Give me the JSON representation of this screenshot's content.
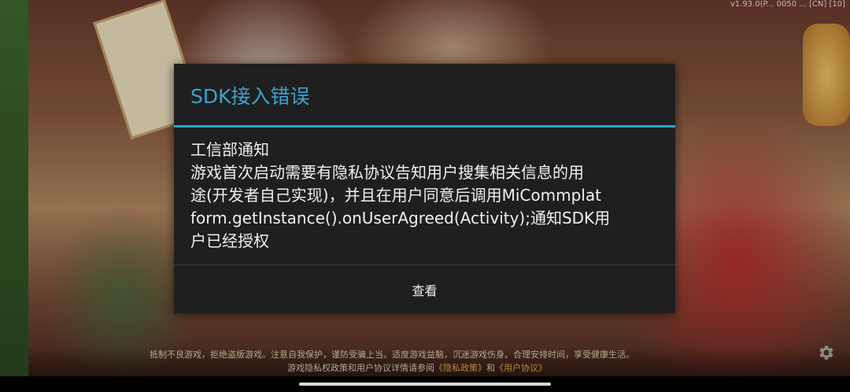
{
  "status": {
    "topright_text": "v1.93.0(P... 0050 ... [CN] [10]"
  },
  "game": {
    "notice_line1": "抵制不良游戏，拒绝盗版游戏。注意自我保护，谨防受骗上当。适度游戏益脑，沉迷游戏伤身。合理安排时间，享受健康生活。",
    "notice_line2_prefix": "游戏隐私权政策和用户协议详情请参阅",
    "privacy_link": "《隐私政策》",
    "and_text": "和",
    "user_agreement_link": "《用户协议》",
    "settings_icon": "gear-icon"
  },
  "dialog": {
    "title": "SDK接入错误",
    "message_lines": [
      "工信部通知",
      "游戏首次启动需要有隐私协议告知用户搜集相关信息的用",
      "途(开发者自己实现)，并且在用户同意后调用MiCommplat",
      "form.getInstance().onUserAgreed(Activity);通知SDK用",
      "户已经授权"
    ],
    "button_label": "查看",
    "accent_color": "#3aa3d2"
  }
}
